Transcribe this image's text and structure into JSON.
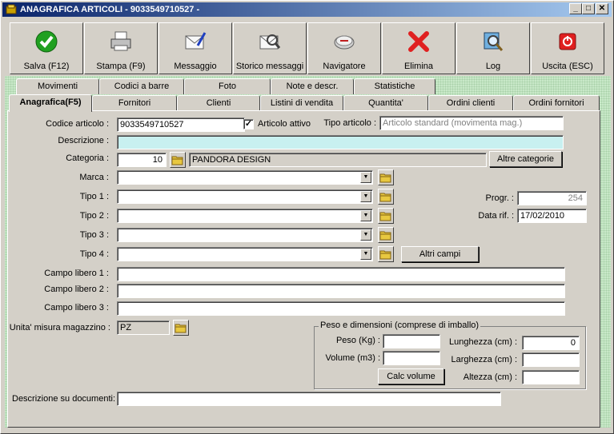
{
  "window": {
    "title": "ANAGRAFICA ARTICOLI - 9033549710527 -",
    "minimize": "_",
    "maximize": "□",
    "close": "✕"
  },
  "toolbar": [
    {
      "label": "Salva (F12)",
      "icon": "checkmark-icon"
    },
    {
      "label": "Stampa (F9)",
      "icon": "printer-icon"
    },
    {
      "label": "Messaggio",
      "icon": "message-icon"
    },
    {
      "label": "Storico messaggi",
      "icon": "message-history-icon"
    },
    {
      "label": "Navigatore",
      "icon": "compass-icon"
    },
    {
      "label": "Elimina",
      "icon": "delete-icon"
    },
    {
      "label": "Log",
      "icon": "log-icon"
    },
    {
      "label": "Uscita (ESC)",
      "icon": "exit-icon"
    }
  ],
  "tabs_row1": [
    "Movimenti",
    "Codici a barre",
    "Foto",
    "Note e descr.",
    "Statistiche"
  ],
  "tabs_row2": [
    "Anagrafica(F5)",
    "Fornitori",
    "Clienti",
    "Listini di vendita",
    "Quantita'",
    "Ordini clienti",
    "Ordini fornitori"
  ],
  "form": {
    "codice_label": "Codice articolo :",
    "codice_value": "9033549710527",
    "attivo_label": "Articolo attivo",
    "attivo_checked": "✓",
    "tipo_articolo_label": "Tipo articolo :",
    "tipo_articolo_value": "Articolo standard (movimenta mag.)",
    "descrizione_label": "Descrizione :",
    "descrizione_value": "",
    "categoria_label": "Categoria :",
    "categoria_code": "10",
    "categoria_name": "PANDORA DESIGN",
    "altre_categorie": "Altre categorie",
    "marca_label": "Marca :",
    "tipo1_label": "Tipo 1 :",
    "tipo2_label": "Tipo 2 :",
    "tipo3_label": "Tipo 3 :",
    "tipo4_label": "Tipo 4 :",
    "altri_campi": "Altri campi",
    "progr_label": "Progr. :",
    "progr_value": "254",
    "data_rif_label": "Data rif. :",
    "data_rif_value": "17/02/2010",
    "libero1_label": "Campo libero 1 :",
    "libero2_label": "Campo libero 2 :",
    "libero3_label": "Campo libero 3 :",
    "um_label": "Unita' misura magazzino :",
    "um_value": "PZ",
    "peso_group": "Peso e dimensioni (comprese di imballo)",
    "peso_label": "Peso (Kg) :",
    "volume_label": "Volume (m3) :",
    "calc_volume": "Calc volume",
    "lunghezza_label": "Lunghezza (cm) :",
    "lunghezza_value": "0",
    "larghezza_label": "Larghezza (cm) :",
    "altezza_label": "Altezza (cm) :",
    "desc_doc_label": "Descrizione su documenti:"
  }
}
